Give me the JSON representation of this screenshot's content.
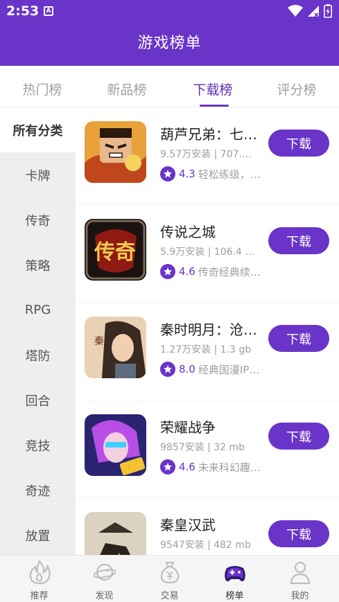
{
  "status_bar": {
    "time": "2:53",
    "sim_icon": "A"
  },
  "app_bar": {
    "title": "游戏榜单"
  },
  "tabs": [
    {
      "label": "热门榜"
    },
    {
      "label": "新品榜"
    },
    {
      "label": "下载榜",
      "active": true
    },
    {
      "label": "评分榜"
    }
  ],
  "categories": [
    {
      "label": "所有分类",
      "active": true
    },
    {
      "label": "卡牌"
    },
    {
      "label": "传奇"
    },
    {
      "label": "策略"
    },
    {
      "label": "RPG"
    },
    {
      "label": "塔防"
    },
    {
      "label": "回合"
    },
    {
      "label": "竞技"
    },
    {
      "label": "奇迹"
    },
    {
      "label": "放置"
    }
  ],
  "games": [
    {
      "name": "葫芦兄弟：七…",
      "meta": "9.57万安装 | 707.3 …",
      "rating": "4.3",
      "desc": "轻松练级，…",
      "button": "下载"
    },
    {
      "name": "传说之城",
      "meta": "5.9万安装 | 106.4 …",
      "rating": "4.6",
      "desc": "传奇经典续…",
      "button": "下载"
    },
    {
      "name": "秦时明月：沧…",
      "meta": "1.27万安装 | 1.3 gb",
      "rating": "8.0",
      "desc": "经典国漫IP…",
      "button": "下载"
    },
    {
      "name": "荣耀战争",
      "meta": "9857安装 | 32 mb",
      "rating": "4.6",
      "desc": "未来科幻趣…",
      "button": "下载"
    },
    {
      "name": "秦皇汉武",
      "meta": "9547安装 | 482 mb",
      "rating": "",
      "desc": "",
      "button": "下载"
    }
  ],
  "bottom_nav": [
    {
      "label": "推荐",
      "icon": "flame-icon"
    },
    {
      "label": "发现",
      "icon": "planet-icon"
    },
    {
      "label": "交易",
      "icon": "money-bag-icon"
    },
    {
      "label": "榜单",
      "icon": "gamepad-icon",
      "active": true
    },
    {
      "label": "我的",
      "icon": "person-icon"
    }
  ],
  "colors": {
    "brand": "#6a34c8",
    "sidebar_bg": "#eeeeee",
    "muted_text": "#9e9e9e"
  }
}
